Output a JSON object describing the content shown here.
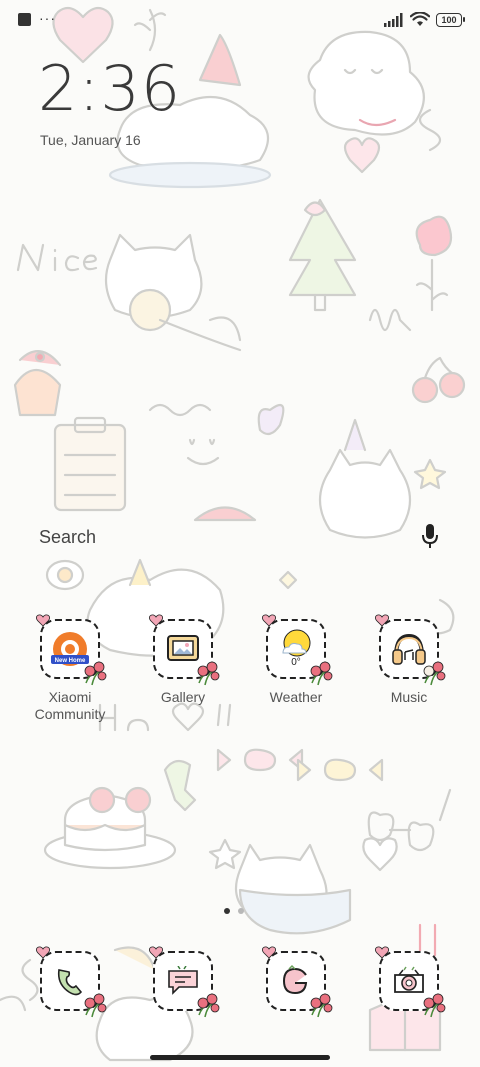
{
  "status_bar": {
    "notification_icon": "stop-square-icon",
    "more_indicator": "···",
    "battery": "100"
  },
  "lock": {
    "time": "2:36",
    "date": "Tue, January 16"
  },
  "search": {
    "label": "Search"
  },
  "apps_row1": [
    {
      "label": "Xiaomi\nCommunity",
      "icon": "xiaomi-community-icon"
    },
    {
      "label": "Gallery",
      "icon": "gallery-icon"
    },
    {
      "label": "Weather",
      "icon": "weather-icon",
      "temp": "0°"
    },
    {
      "label": "Music",
      "icon": "music-icon"
    }
  ],
  "dock": [
    {
      "icon": "phone-icon"
    },
    {
      "icon": "messages-icon"
    },
    {
      "icon": "google-icon"
    },
    {
      "icon": "camera-icon"
    }
  ],
  "page_indicator": {
    "total": 2,
    "active": 1
  },
  "colors": {
    "accent_pink": "#f0a0b0",
    "dot_active": "#333333",
    "dot_inactive": "#b8b8b8"
  }
}
